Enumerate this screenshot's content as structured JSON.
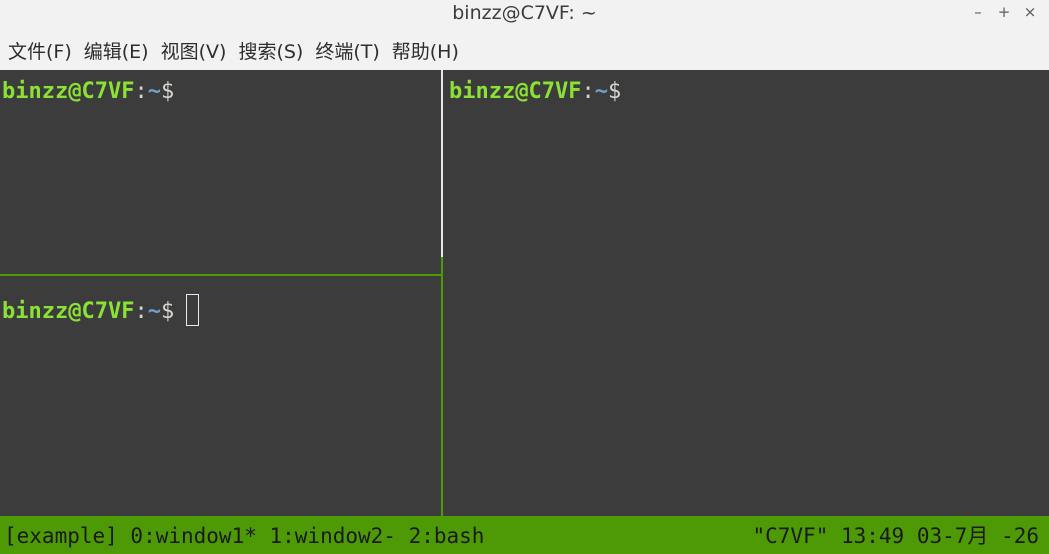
{
  "window": {
    "title": "binzz@C7VF: ~",
    "controls": {
      "minimize": "–",
      "maximize": "+",
      "close": "×"
    }
  },
  "menu": {
    "items": [
      {
        "label": "文件(F)"
      },
      {
        "label": "编辑(E)"
      },
      {
        "label": "视图(V)"
      },
      {
        "label": "搜索(S)"
      },
      {
        "label": "终端(T)"
      },
      {
        "label": "帮助(H)"
      }
    ]
  },
  "panes": {
    "top_left": {
      "user_host": "binzz@C7VF",
      "colon": ":",
      "path": "~",
      "dollar": "$"
    },
    "bottom_left": {
      "user_host": "binzz@C7VF",
      "colon": ":",
      "path": "~",
      "dollar": "$"
    },
    "right": {
      "user_host": "binzz@C7VF",
      "colon": ":",
      "path": "~",
      "dollar": "$"
    }
  },
  "status": {
    "left": "[example] 0:window1* 1:window2- 2:bash",
    "right": "\"C7VF\" 13:49 03-7月 -26"
  },
  "colors": {
    "terminal_bg": "#3c3c3c",
    "prompt_user": "#8ae234",
    "prompt_path": "#729fcf",
    "status_bg": "#4e9a06",
    "active_border": "#4e9a06",
    "inactive_border": "#e8e8e8"
  }
}
